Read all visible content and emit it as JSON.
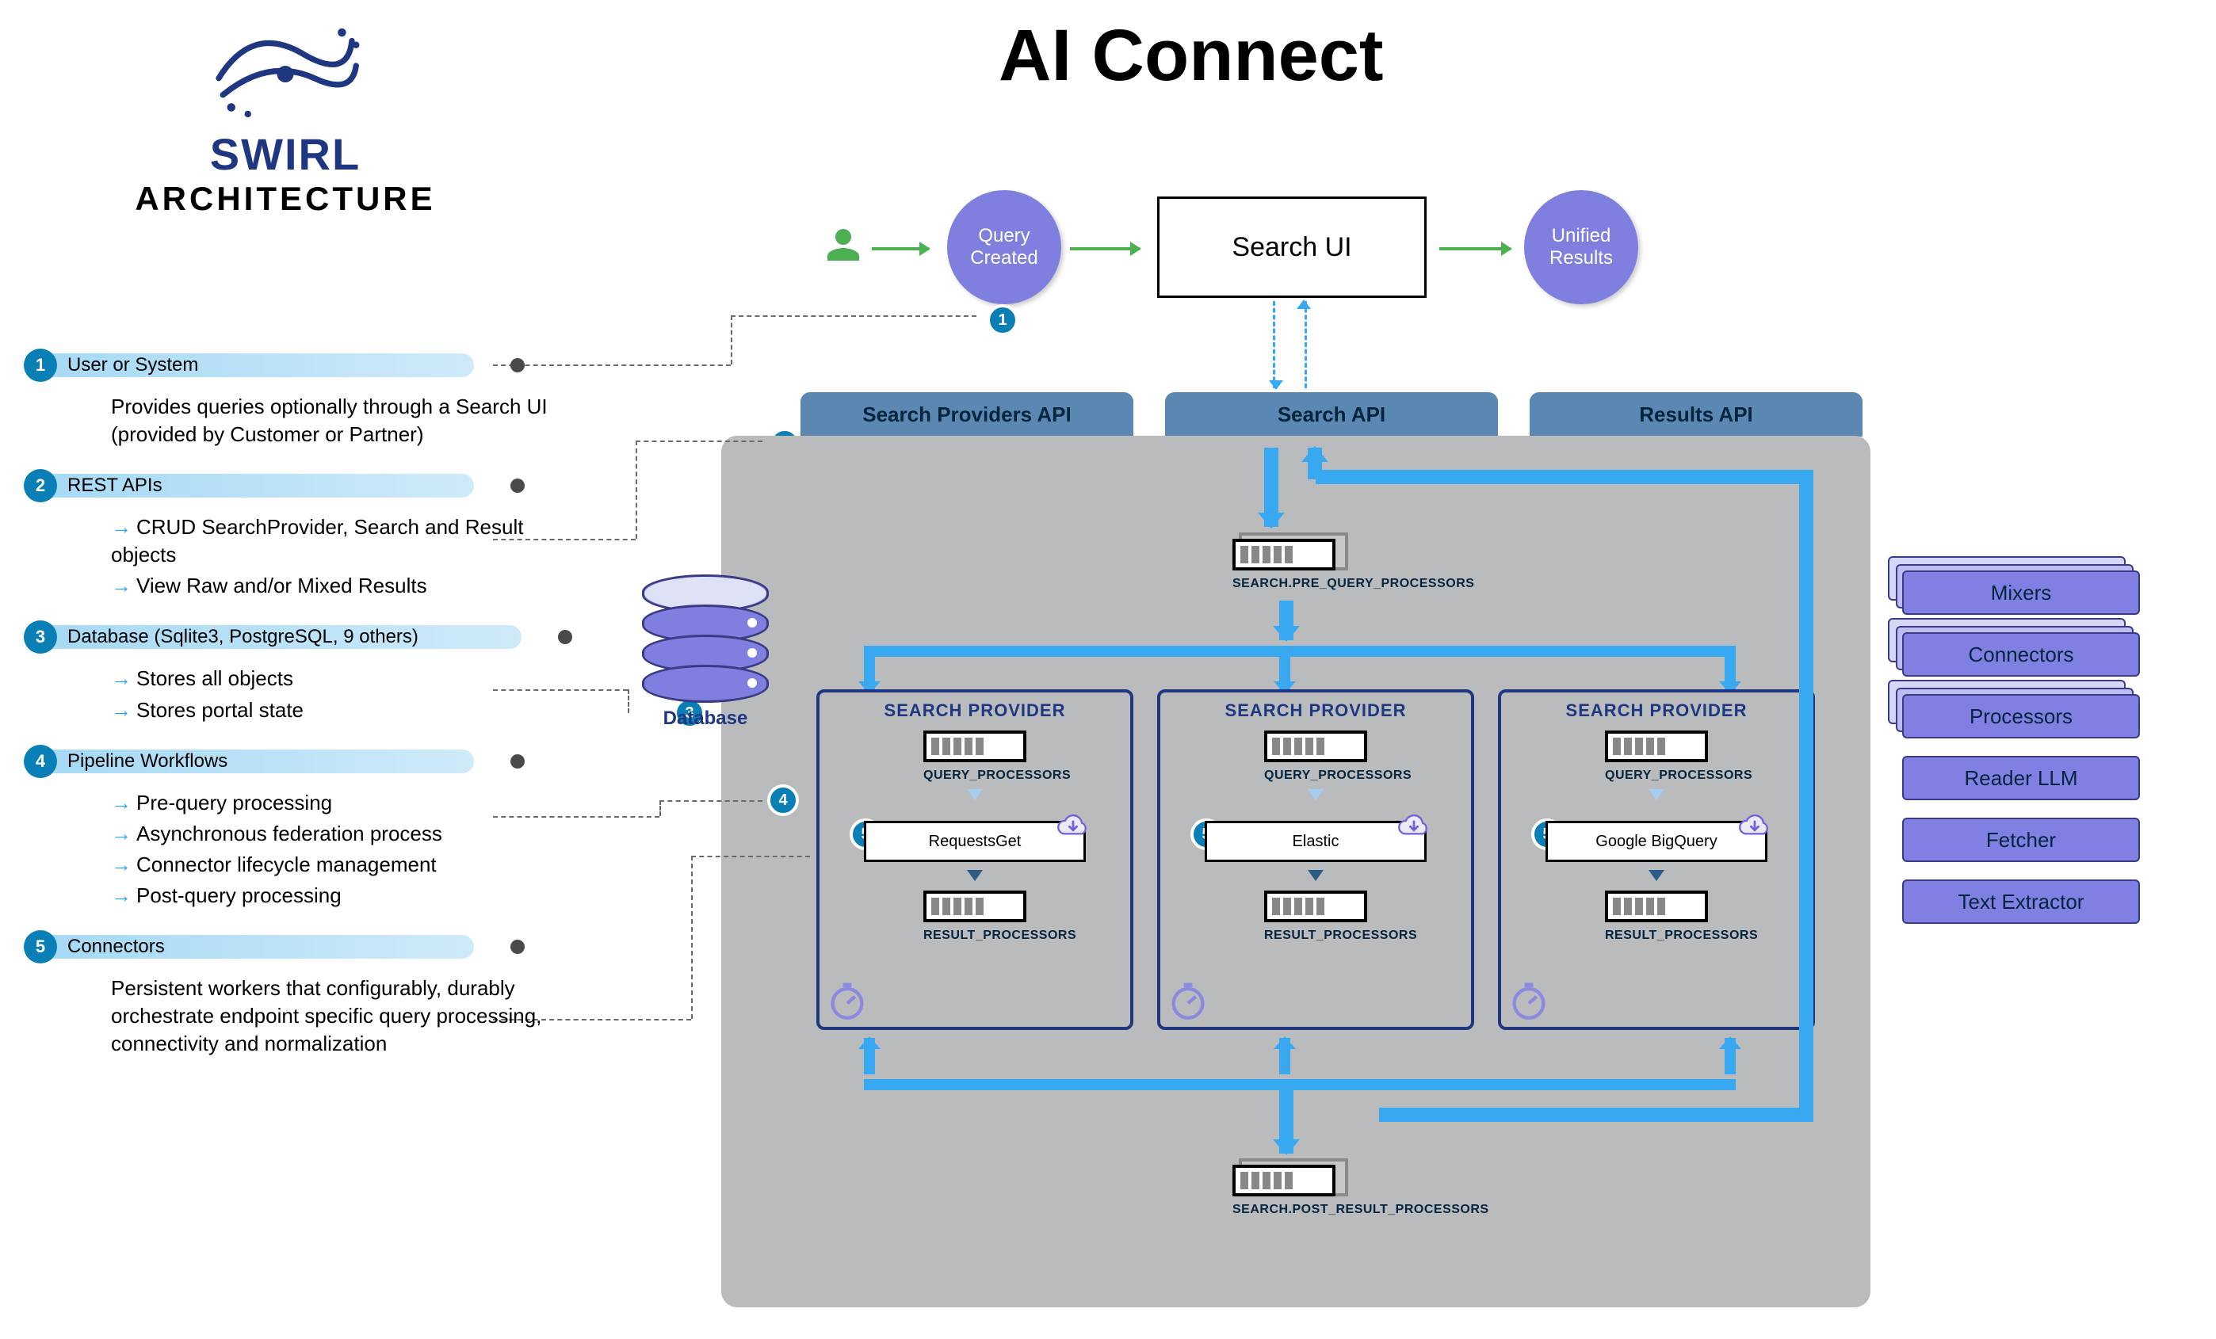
{
  "brand": {
    "name": "SWIRL",
    "subtitle": "ARCHITECTURE"
  },
  "title": "AI Connect",
  "top_flow": {
    "query_node": "Query Created",
    "search_ui": "Search UI",
    "results_node": "Unified Results"
  },
  "api_tabs": {
    "providers": "Search Providers API",
    "search": "Search API",
    "results": "Results API"
  },
  "processors": {
    "pre": "SEARCH.PRE_QUERY_PROCESSORS",
    "post": "SEARCH.POST_RESULT_PROCESSORS",
    "query": "QUERY_PROCESSORS",
    "result": "RESULT_PROCESSORS"
  },
  "provider_title": "SEARCH PROVIDER",
  "providers": [
    {
      "connector": "RequestsGet"
    },
    {
      "connector": "Elastic"
    },
    {
      "connector": "Google BigQuery"
    }
  ],
  "db_label": "Database",
  "legend": [
    {
      "num": "1",
      "title": "User or System",
      "desc": "Provides queries optionally through a Search UI (provided by Customer or Partner)",
      "bullets": []
    },
    {
      "num": "2",
      "title": "REST APIs",
      "desc": "",
      "bullets": [
        "CRUD SearchProvider, Search and Result objects",
        "View Raw and/or Mixed Results"
      ]
    },
    {
      "num": "3",
      "title": "Database (Sqlite3, PostgreSQL, 9 others)",
      "desc": "",
      "bullets": [
        "Stores all objects",
        "Stores portal state"
      ]
    },
    {
      "num": "4",
      "title": "Pipeline Workflows",
      "desc": "",
      "bullets": [
        "Pre-query processing",
        "Asynchronous federation process",
        "Connector lifecycle management",
        "Post-query processing"
      ]
    },
    {
      "num": "5",
      "title": "Connectors",
      "desc": "Persistent workers that configurably, durably orchestrate endpoint specific query processing, connectivity and normalization",
      "bullets": []
    }
  ],
  "caps": [
    "Mixers",
    "Connectors",
    "Processors",
    "Reader LLM",
    "Fetcher",
    "Text Extractor"
  ]
}
